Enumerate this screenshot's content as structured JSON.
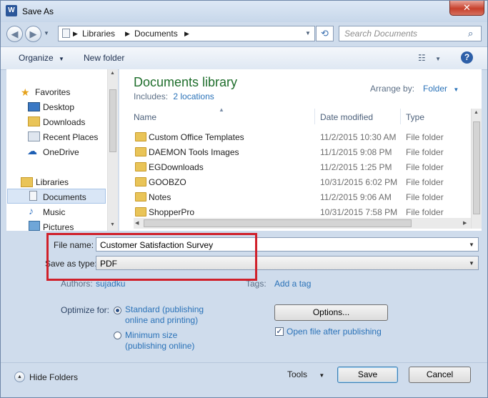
{
  "window": {
    "title": "Save As",
    "app_icon": "W",
    "close_glyph": "✕"
  },
  "address": {
    "crumbs": [
      "Libraries",
      "Documents"
    ],
    "search_placeholder": "Search Documents"
  },
  "toolbar": {
    "organize": "Organize",
    "new_folder": "New folder"
  },
  "nav": {
    "favorites_label": "Favorites",
    "favorites": [
      "Desktop",
      "Downloads",
      "Recent Places",
      "OneDrive"
    ],
    "libraries_label": "Libraries",
    "libraries": [
      "Documents",
      "Music",
      "Pictures"
    ]
  },
  "library": {
    "title": "Documents library",
    "includes_label": "Includes:",
    "includes_link": "2 locations",
    "arrange_label": "Arrange by:",
    "arrange_value": "Folder"
  },
  "columns": {
    "name": "Name",
    "date": "Date modified",
    "type": "Type"
  },
  "files": [
    {
      "name": "Custom Office Templates",
      "date": "11/2/2015 10:30 AM",
      "type": "File folder"
    },
    {
      "name": "DAEMON Tools Images",
      "date": "11/1/2015 9:08 PM",
      "type": "File folder"
    },
    {
      "name": "EGDownloads",
      "date": "11/2/2015 1:25 PM",
      "type": "File folder"
    },
    {
      "name": "GOOBZO",
      "date": "10/31/2015 6:02 PM",
      "type": "File folder"
    },
    {
      "name": "Notes",
      "date": "11/2/2015 9:06 AM",
      "type": "File folder"
    },
    {
      "name": "ShopperPro",
      "date": "10/31/2015 7:58 PM",
      "type": "File folder"
    }
  ],
  "form": {
    "file_name_label": "File name:",
    "file_name_value": "Customer Satisfaction Survey",
    "save_type_label": "Save as type:",
    "save_type_value": "PDF",
    "authors_label": "Authors:",
    "authors_value": "sujadku",
    "tags_label": "Tags:",
    "tags_value": "Add a tag"
  },
  "options": {
    "optimize_label": "Optimize for:",
    "standard": "Standard (publishing online and printing)",
    "minimum": "Minimum size (publishing online)",
    "options_button": "Options...",
    "open_after": "Open file after publishing"
  },
  "footer": {
    "hide_folders": "Hide Folders",
    "tools": "Tools",
    "save": "Save",
    "cancel": "Cancel"
  },
  "colors": {
    "highlight_box": "#d0202a",
    "library_title": "#1f6e2c",
    "link": "#2a72b8"
  }
}
